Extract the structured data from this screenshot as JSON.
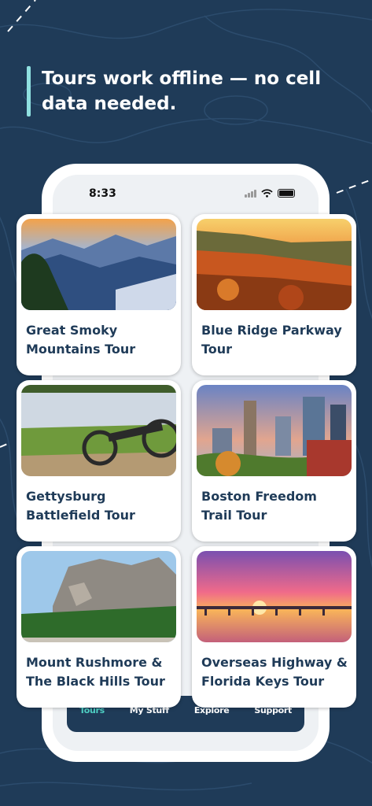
{
  "headline": "Tours work offline — no cell data needed.",
  "status_bar": {
    "time": "8:33"
  },
  "tours": [
    {
      "title": "Great Smoky Mountains Tour"
    },
    {
      "title": "Blue Ridge Parkway Tour"
    },
    {
      "title": "Gettysburg Battlefield Tour"
    },
    {
      "title": "Boston Freedom Trail Tour"
    },
    {
      "title": "Mount Rushmore & The Black Hills Tour"
    },
    {
      "title": "Overseas Highway & Florida Keys Tour"
    }
  ],
  "tab_bar": {
    "items": [
      {
        "label": "Tours",
        "active": true
      },
      {
        "label": "My Stuff",
        "active": false
      },
      {
        "label": "Explore",
        "active": false
      },
      {
        "label": "Support",
        "active": false
      }
    ]
  },
  "colors": {
    "background": "#1f3b58",
    "accent": "#8fe0e0",
    "active_tab": "#4fd1c5",
    "card_title": "#1f3b58"
  }
}
